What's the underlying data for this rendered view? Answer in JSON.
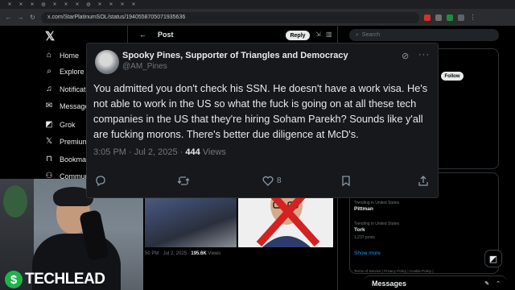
{
  "browser": {
    "url": "x.com/StarPlatinumSOL/status/1940558705071935636"
  },
  "nav": {
    "items": [
      {
        "label": "Home",
        "icon": "home-icon"
      },
      {
        "label": "Explore",
        "icon": "search-icon"
      },
      {
        "label": "Notifications",
        "icon": "bell-icon"
      },
      {
        "label": "Messages",
        "icon": "mail-icon"
      },
      {
        "label": "Grok",
        "icon": "grok-icon"
      },
      {
        "label": "Premium",
        "icon": "x-icon"
      },
      {
        "label": "Bookmarks",
        "icon": "bookmark-icon"
      },
      {
        "label": "Communities",
        "icon": "people-icon"
      }
    ]
  },
  "main": {
    "title": "Post",
    "reply_label": "Reply",
    "bg_meta": {
      "time": "50 PM · Jul 2, 2025 · ",
      "views": "195.6K",
      "views_suffix": " Views"
    }
  },
  "right": {
    "search_placeholder": "Search",
    "follow_label": "Follow",
    "trends": [
      {
        "context": "Trending in United States",
        "name": "Pittman",
        "count": ""
      },
      {
        "context": "Trending in United States",
        "name": "Tork",
        "count": "1,237 posts"
      }
    ],
    "show_more": "Show more",
    "footer": "Terms of Service  |  Privacy Policy  |  Cookie Policy  |"
  },
  "messages_bar": {
    "label": "Messages"
  },
  "brand": {
    "symbol": "$",
    "text": "TECHLEAD"
  },
  "tweet": {
    "name": "Spooky Pines, Supporter of Triangles and Democracy",
    "handle": "@AM_Pines",
    "body": "You admitted you don't check his SSN. He doesn't have a work visa. He's not able to work in the US so what the fuck is going on at all these tech companies  in the US that they're hiring Soham Parekh? Sounds like y'all are fucking morons. There's better due diligence at McD's.",
    "time": "3:05 PM · Jul 2, 2025 · ",
    "views": "444",
    "views_label": " Views",
    "likes": "8"
  }
}
